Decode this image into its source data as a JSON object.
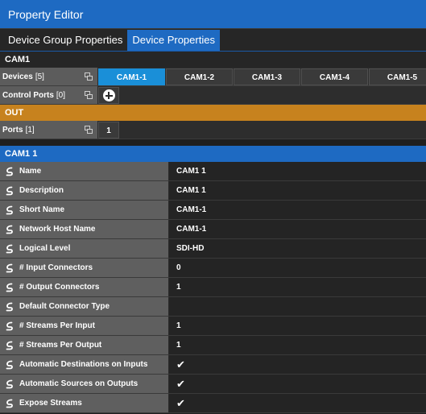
{
  "window": {
    "title": "Property Editor"
  },
  "tabs": [
    {
      "label": "Device Group Properties",
      "active": false
    },
    {
      "label": "Device Properties",
      "active": true
    }
  ],
  "group": {
    "name": "CAM1",
    "devices": {
      "label": "Devices",
      "count": "[5]",
      "items": [
        "CAM1-1",
        "CAM1-2",
        "CAM1-3",
        "CAM1-4",
        "CAM1-5"
      ],
      "selected": "CAM1-1"
    },
    "control_ports": {
      "label": "Control Ports",
      "count": "[0]"
    }
  },
  "out": {
    "title": "OUT",
    "ports": {
      "label": "Ports",
      "count": "[1]",
      "items": [
        "1"
      ]
    }
  },
  "device": {
    "title": "CAM1 1",
    "properties": [
      {
        "label": "Name",
        "value": "CAM1 1"
      },
      {
        "label": "Description",
        "value": "CAM1 1"
      },
      {
        "label": "Short Name",
        "value": "CAM1-1"
      },
      {
        "label": "Network Host Name",
        "value": "CAM1-1"
      },
      {
        "label": "Logical Level",
        "value": "SDI-HD"
      },
      {
        "label": "# Input Connectors",
        "value": "0"
      },
      {
        "label": "# Output Connectors",
        "value": "1"
      },
      {
        "label": "Default Connector Type",
        "value": ""
      },
      {
        "label": "# Streams Per Input",
        "value": "1"
      },
      {
        "label": "# Streams Per Output",
        "value": "1"
      },
      {
        "label": "Automatic Destinations on Inputs",
        "value": "✔"
      },
      {
        "label": "Automatic Sources on Outputs",
        "value": "✔"
      },
      {
        "label": "Expose Streams",
        "value": "✔"
      }
    ]
  },
  "colors": {
    "accent_blue": "#1e6ac2",
    "selected_chip": "#1a8fd8",
    "out_header": "#c7821e",
    "label_bg": "#5f5f5f",
    "value_bg": "#242424"
  },
  "icons": {
    "property": "link-icon",
    "filter": "filter-icon",
    "add": "plus-circle-icon"
  }
}
